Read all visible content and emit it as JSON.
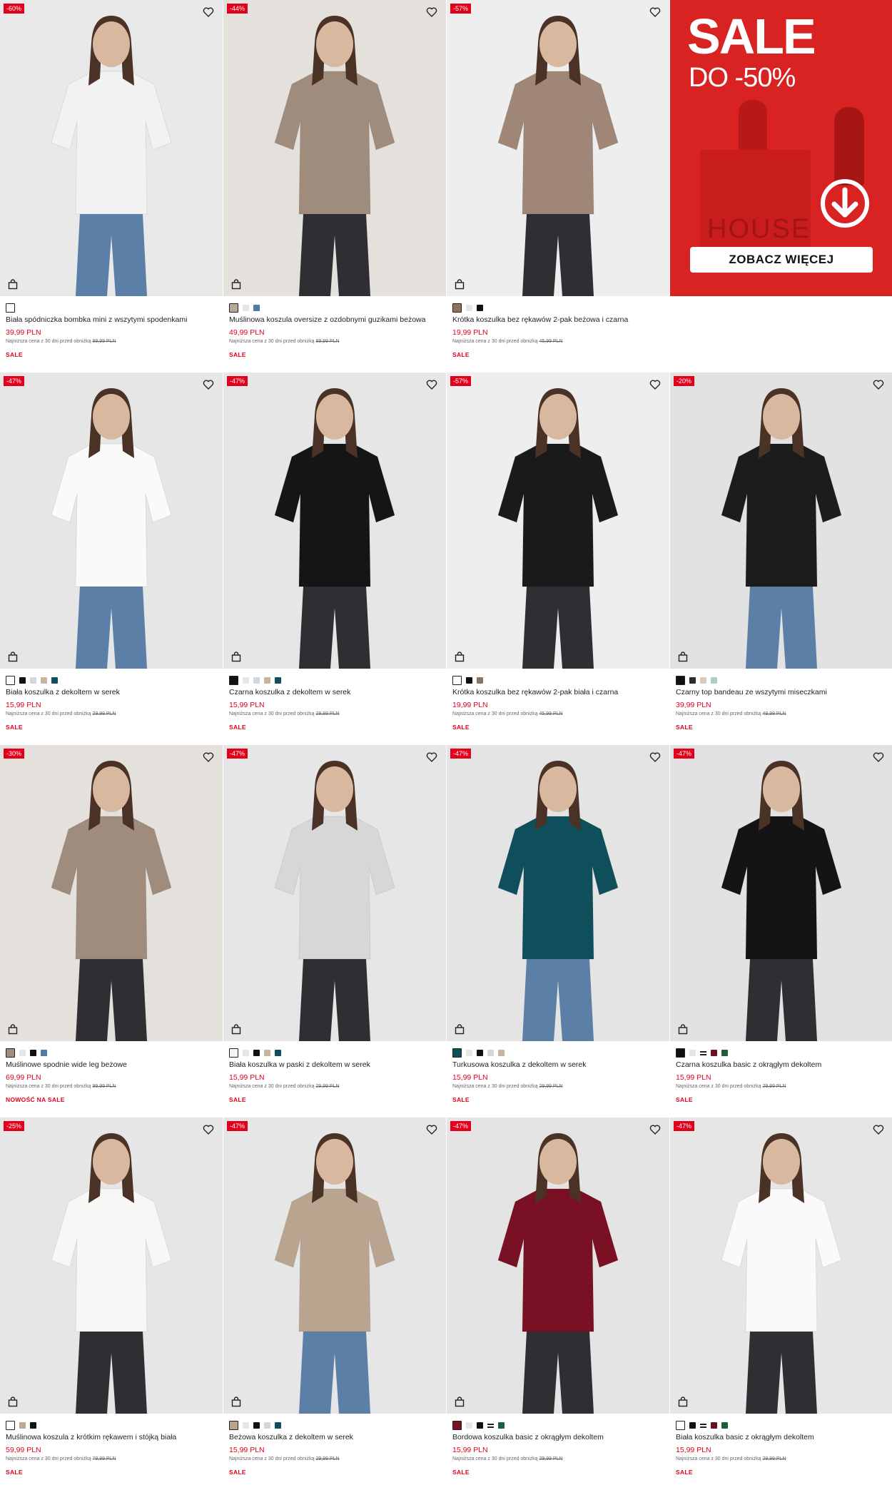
{
  "colors": {
    "accent": "#e3001b",
    "promo_bg": "#d92222"
  },
  "promo": {
    "sale": "SALE",
    "discount": "DO -50%",
    "brand": "HOUSE",
    "cta": "ZOBACZ WIĘCEJ"
  },
  "products": [
    {
      "badge": "-60%",
      "name": "Biała spódniczka bombka mini z wszytymi spodenkami",
      "price": "39,99 PLN",
      "lowest_label": "Najniższa cena z 30 dni przed obniżką",
      "lowest_price": "99,99 PLN",
      "tag": "SALE",
      "bg": "#e9e9e9",
      "figure": "#f2f2f2",
      "swatches": [
        "#ffffff"
      ]
    },
    {
      "badge": "-44%",
      "name": "Muślinowa koszula oversize z ozdobnymi guzikami beżowa",
      "price": "49,99 PLN",
      "lowest_label": "Najniższa cena z 30 dni przed obniżką",
      "lowest_price": "89,99 PLN",
      "tag": "SALE",
      "bg": "#e4e1dd",
      "figure": "#a08c7c",
      "swatches": [
        "#bba895",
        "#e6e6e6",
        "#4f79a6"
      ]
    },
    {
      "badge": "-57%",
      "name": "Krótka koszulka bez rękawów 2-pak beżowa i czarna",
      "price": "19,99 PLN",
      "lowest_label": "Najniższa cena z 30 dni przed obniżką",
      "lowest_price": "45,99 PLN",
      "tag": "SALE",
      "bg": "#eeeeee",
      "figure": "#9f8677",
      "swatches": [
        "#8c7465",
        "#e6e6e6",
        "#111111"
      ]
    },
    {
      "badge": "-47%",
      "name": "Biała koszulka z dekoltem w serek",
      "price": "15,99 PLN",
      "lowest_label": "Najniższa cena z 30 dni przed obniżką",
      "lowest_price": "29,99 PLN",
      "tag": "SALE",
      "bg": "#e6e6e6",
      "figure": "#fafafa",
      "swatches": [
        "#ffffff",
        "#111111",
        "#cfd8dc",
        "#c8b49f",
        "#0f4f5c"
      ]
    },
    {
      "badge": "-47%",
      "name": "Czarna koszulka z dekoltem w serek",
      "price": "15,99 PLN",
      "lowest_label": "Najniższa cena z 30 dni przed obniżką",
      "lowest_price": "29,99 PLN",
      "tag": "SALE",
      "bg": "#e6e6e6",
      "figure": "#151515",
      "swatches": [
        "#111111",
        "#e6e6e6",
        "#cfd8dc",
        "#c8b49f",
        "#0f4f5c"
      ]
    },
    {
      "badge": "-57%",
      "name": "Krótka koszulka bez rękawów 2-pak biała i czarna",
      "price": "19,99 PLN",
      "lowest_label": "Najniższa cena z 30 dni przed obniżką",
      "lowest_price": "45,99 PLN",
      "tag": "SALE",
      "bg": "#eeeeee",
      "figure": "#1a1a1a",
      "swatches": [
        "#ffffff",
        "#111111",
        "#8c7465"
      ]
    },
    {
      "badge": "-20%",
      "name": "Czarny top bandeau ze wszytymi miseczkami",
      "price": "39,99 PLN",
      "lowest_label": "Najniższa cena z 30 dni przed obniżką",
      "lowest_price": "49,99 PLN",
      "tag": "SALE",
      "bg": "#e2e2e2",
      "figure": "#1c1c1c",
      "swatches": [
        "#111111",
        "#2b2b2b",
        "#d8c9b8",
        "#a9cfc8"
      ]
    },
    {
      "badge": "-30%",
      "name": "Muślinowe spodnie wide leg beżowe",
      "price": "69,99 PLN",
      "lowest_label": "Najniższa cena z 30 dni przed obniżką",
      "lowest_price": "99,99 PLN",
      "tag": "NOWOŚĆ NA SALE",
      "bg": "#e4e1dd",
      "figure": "#a08c7c",
      "swatches": [
        "#a08c7c",
        "#e6e6e6",
        "#111111",
        "#4f79a6"
      ]
    },
    {
      "badge": "-47%",
      "name": "Biała koszulka w paski z dekoltem w serek",
      "price": "15,99 PLN",
      "lowest_label": "Najniższa cena z 30 dni przed obniżką",
      "lowest_price": "29,99 PLN",
      "tag": "SALE",
      "bg": "#e6e6e6",
      "figure": "#d7d7d7",
      "swatches": [
        "#f4f4f4",
        "#e6e6e6",
        "#111111",
        "#c8b49f",
        "#0f4f5c"
      ]
    },
    {
      "badge": "-47%",
      "name": "Turkusowa koszulka z dekoltem w serek",
      "price": "15,99 PLN",
      "lowest_label": "Najniższa cena z 30 dni przed obniżką",
      "lowest_price": "29,99 PLN",
      "tag": "SALE",
      "bg": "#e4e4e4",
      "figure": "#0f4f5c",
      "swatches": [
        "#0f4f5c",
        "#e6e6e6",
        "#111111",
        "#cfd8dc",
        "#c8b49f"
      ]
    },
    {
      "badge": "-47%",
      "name": "Czarna koszulka basic z okrągłym dekoltem",
      "price": "15,99 PLN",
      "lowest_label": "Najniższa cena z 30 dni przed obniżką",
      "lowest_price": "29,99 PLN",
      "tag": "SALE",
      "bg": "#e2e2e2",
      "figure": "#141414",
      "swatches": [
        "#111111",
        "#e6e6e6",
        "stripe",
        "#6b1020",
        "#1f5c3a"
      ]
    },
    {
      "badge": "-25%",
      "name": "Muślinowa koszula z krótkim rękawem i stójką biała",
      "price": "59,99 PLN",
      "lowest_label": "Najniższa cena z 30 dni przed obniżką",
      "lowest_price": "79,99 PLN",
      "tag": "SALE",
      "bg": "#e6e6e6",
      "figure": "#f7f7f5",
      "swatches": [
        "#ffffff",
        "#bba895",
        "#111111"
      ]
    },
    {
      "badge": "-47%",
      "name": "Beżowa koszulka z dekoltem w serek",
      "price": "15,99 PLN",
      "lowest_label": "Najniższa cena z 30 dni przed obniżką",
      "lowest_price": "29,99 PLN",
      "tag": "SALE",
      "bg": "#e6e6e6",
      "figure": "#b9a58f",
      "swatches": [
        "#b9a58f",
        "#e6e6e6",
        "#111111",
        "#cfd8dc",
        "#0f4f5c"
      ]
    },
    {
      "badge": "-47%",
      "name": "Bordowa koszulka basic z okrągłym dekoltem",
      "price": "15,99 PLN",
      "lowest_label": "Najniższa cena z 30 dni przed obniżką",
      "lowest_price": "29,99 PLN",
      "tag": "SALE",
      "bg": "#e4e4e4",
      "figure": "#7a1024",
      "swatches": [
        "#7a1024",
        "#e6e6e6",
        "#111111",
        "stripe",
        "#1f5c3a"
      ]
    },
    {
      "badge": "-47%",
      "name": "Biała koszulka basic z okrągłym dekoltem",
      "price": "15,99 PLN",
      "lowest_label": "Najniższa cena z 30 dni przed obniżką",
      "lowest_price": "29,99 PLN",
      "tag": "SALE",
      "bg": "#e6e6e6",
      "figure": "#fafafa",
      "swatches": [
        "#ffffff",
        "#111111",
        "stripe",
        "#6b1020",
        "#1f5c3a"
      ]
    }
  ]
}
